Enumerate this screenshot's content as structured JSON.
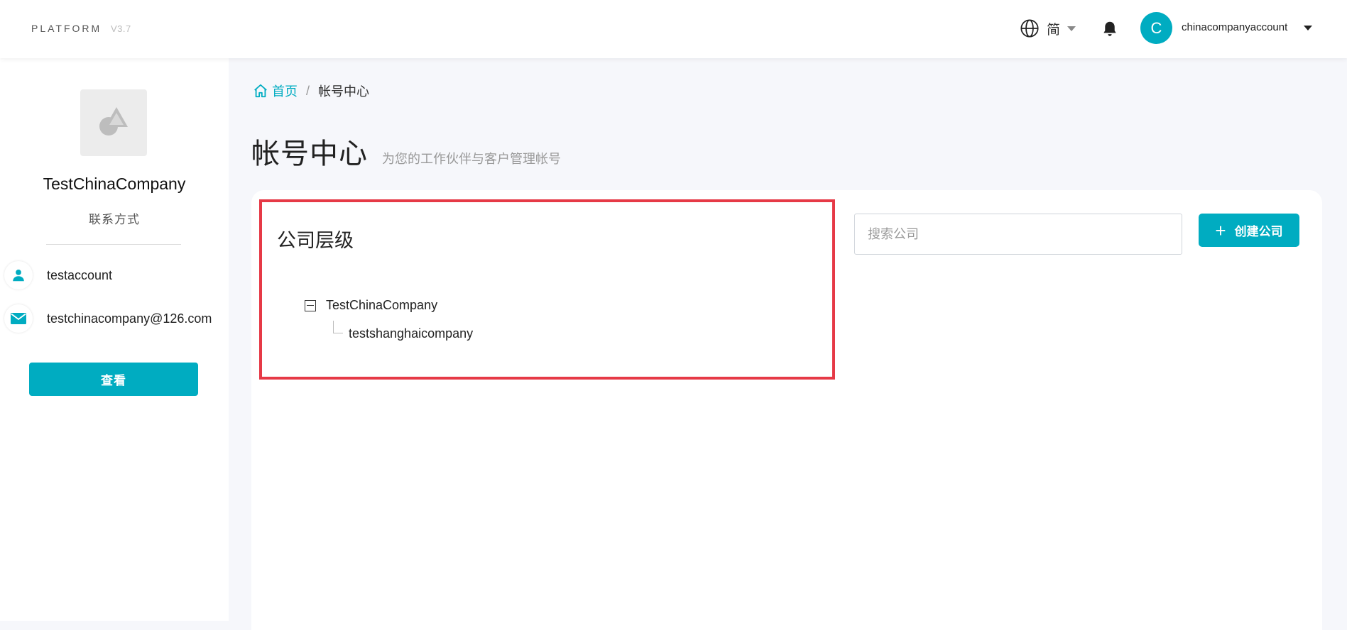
{
  "header": {
    "brand": "PLATFORM",
    "version": "V3.7",
    "language": "简",
    "avatar_initial": "C",
    "username": "chinacompanyaccount"
  },
  "sidebar": {
    "company_name": "TestChinaCompany",
    "contact_label": "联系方式",
    "account": "testaccount",
    "email": "testchinacompany@126.com",
    "view_button": "查看"
  },
  "breadcrumb": {
    "home": "首页",
    "separator": "/",
    "current": "帐号中心"
  },
  "page": {
    "title": "帐号中心",
    "subtitle": "为您的工作伙伴与客户管理帐号"
  },
  "hierarchy": {
    "title": "公司层级",
    "root": "TestChinaCompany",
    "child": "testshanghaicompany"
  },
  "search": {
    "placeholder": "搜索公司",
    "value": ""
  },
  "create_button": "创建公司",
  "colors": {
    "accent": "#00acc1",
    "highlight": "#e63946"
  },
  "icons": [
    "globe-icon",
    "bell-icon",
    "person-icon",
    "mail-icon",
    "home-icon",
    "plus-icon"
  ]
}
